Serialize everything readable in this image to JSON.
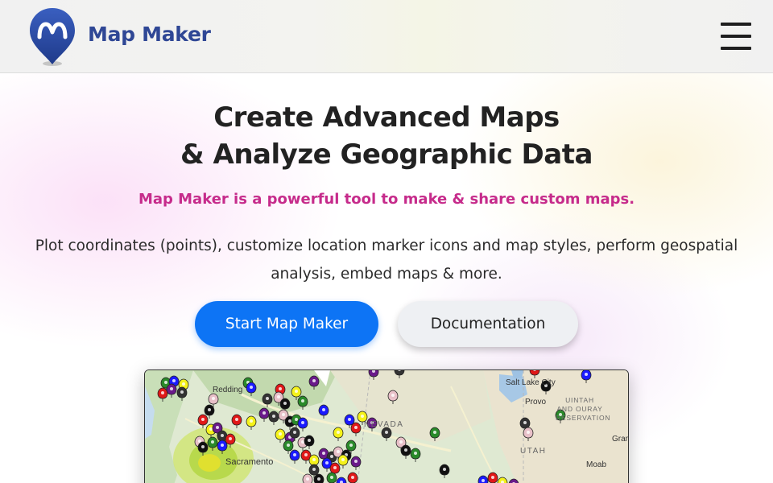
{
  "header": {
    "brand": "Map Maker",
    "logo_icon": "map-pin-m-icon",
    "menu_icon": "hamburger-menu-icon",
    "colors": {
      "brand": "#2f4795",
      "pin": "#2f4fa3"
    }
  },
  "hero": {
    "title_line1": "Create Advanced Maps",
    "title_line2": "& Analyze Geographic Data",
    "tagline": "Map Maker is a powerful tool to make & share custom maps.",
    "description": "Plot coordinates (points), customize location marker icons and map styles, perform geospatial analysis, embed maps & more.",
    "primary_button": "Start Map Maker",
    "secondary_button": "Documentation",
    "colors": {
      "tagline": "#c62b8b",
      "primary_button": "#0d74f5",
      "secondary_button": "#eef0f3"
    }
  },
  "map_preview": {
    "labels": {
      "redding": "Redding",
      "sacramento": "Sacramento",
      "nevada": "NEVADA",
      "utah": "UTAH",
      "salt_lake_city": "Salt Lake City",
      "provo": "Provo",
      "uintah_line1": "UINTAH",
      "uintah_line2": "AND OURAY",
      "uintah_line3": "RESERVATION",
      "moab": "Moab",
      "gran": "Gran"
    },
    "marker_colors": [
      "#2a8a2a",
      "#1a1aff",
      "#e01818",
      "#f4f21a",
      "#6a1a8a",
      "#333333",
      "#e8c0c8",
      "#111111"
    ]
  }
}
